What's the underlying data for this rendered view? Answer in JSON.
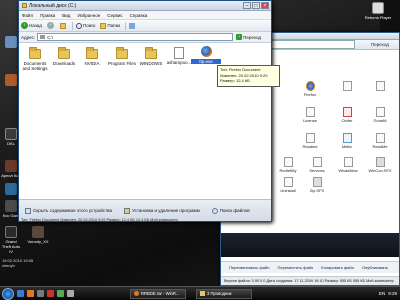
{
  "desktop": {
    "left_icons": [
      {
        "label": ""
      },
      {
        "label": ""
      },
      {
        "label": "DKL"
      },
      {
        "label": "Арнол Кон"
      },
      {
        "label": ""
      },
      {
        "label": "Kcc Gam"
      },
      {
        "label": "Grand Theft Auto IV"
      },
      {
        "label": "Voronty_XX"
      }
    ],
    "right_icons": [
      {
        "label": "Returns Player"
      }
    ],
    "date_overlay": "19.02.2010 19:05 zimnyh"
  },
  "front_window": {
    "title": "Локальный диск (C:)",
    "menu": [
      "Файл",
      "Правка",
      "Вид",
      "Избранное",
      "Сервис",
      "Справка"
    ],
    "toolbar": {
      "back_label": "Назад",
      "search_label": "Поиск",
      "folders_label": "Папки"
    },
    "address_label": "Адрес:",
    "address_value": "C:\\",
    "go_label": "Переход",
    "files": [
      {
        "name": "Documents and Settings",
        "type": "folder"
      },
      {
        "name": "Downloads",
        "type": "folder"
      },
      {
        "name": "NVIDIA",
        "type": "folder"
      },
      {
        "name": "Program Files",
        "type": "folder"
      },
      {
        "name": "WINDOWS",
        "type": "folder"
      },
      {
        "name": "ashampoo...",
        "type": "doc"
      },
      {
        "name": "ttp.exe",
        "type": "firefox",
        "selected": true
      }
    ],
    "tooltip": {
      "line1": "Тип: Firefox Document",
      "line2": "Изменен: 20.02.2010 9:29",
      "line3": "Размер: 12,4 КБ"
    },
    "bottom_actions": [
      {
        "label": "Скрыть содержимое этого устройства"
      },
      {
        "label": "Установка и удаление программ"
      },
      {
        "label": "Поиск файлов"
      }
    ],
    "status": "Тип: Firefox Document Изменен: 20.02.2010 9:29 Размер: 12,4 КБ    12,4 КБ    Мой компьютер"
  },
  "back_window": {
    "go_label": "Переход",
    "files": [
      {
        "name": "Firefox"
      },
      {
        "name": ""
      },
      {
        "name": ""
      },
      {
        "name": "License"
      },
      {
        "name": "Olofer"
      },
      {
        "name": "ПолиМ"
      },
      {
        "name": "Readme"
      },
      {
        "name": "Mellic"
      },
      {
        "name": "ReadMe"
      },
      {
        "name": "RedlefMy"
      },
      {
        "name": "Services"
      },
      {
        "name": "WhatsNew"
      },
      {
        "name": "WinCon.SFX"
      },
      {
        "name": "Uninstall"
      },
      {
        "name": "Zip.SFX"
      }
    ],
    "actions": [
      {
        "label": "Переименовать файл"
      },
      {
        "label": "Переместить файл"
      },
      {
        "label": "Копировать файл"
      },
      {
        "label": "Опубликовать"
      }
    ],
    "status": "Версия файла: 3.90.0.0 Дата создания: 17.11.2009 19:10 Размер: 955 КБ   955 КБ   Мой компьютер"
  },
  "taskbar": {
    "tasks": [
      {
        "label": "RRBDE.rar - WinR..."
      },
      {
        "label": "3 Проводник"
      }
    ],
    "tray_lang": "EN",
    "clock": "9:29"
  },
  "colors": {
    "accent": "#1c4e82",
    "folder": "#e9c45a",
    "selection": "#3366cc",
    "tooltip_bg": "#ffffe1"
  }
}
